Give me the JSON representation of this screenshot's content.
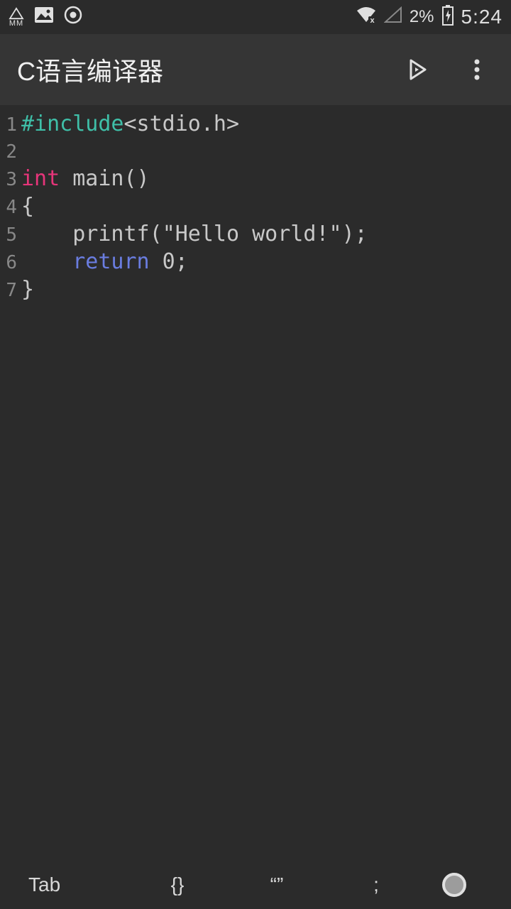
{
  "status": {
    "battery_pct": "2%",
    "time": "5:24",
    "mm_label": "MM"
  },
  "header": {
    "title": "C语言编译器"
  },
  "code": {
    "lines": [
      {
        "n": "1",
        "segments": [
          {
            "t": "#include",
            "c": "k-pre"
          },
          {
            "t": "<stdio.h>",
            "c": ""
          }
        ]
      },
      {
        "n": "2",
        "segments": []
      },
      {
        "n": "3",
        "segments": [
          {
            "t": "int",
            "c": "k-type"
          },
          {
            "t": " main()",
            "c": ""
          }
        ]
      },
      {
        "n": "4",
        "segments": [
          {
            "t": "{",
            "c": ""
          }
        ]
      },
      {
        "n": "5",
        "segments": [
          {
            "t": "    printf(",
            "c": ""
          },
          {
            "t": "\"Hello world!\"",
            "c": "k-str"
          },
          {
            "t": ");",
            "c": ""
          }
        ]
      },
      {
        "n": "6",
        "segments": [
          {
            "t": "    ",
            "c": ""
          },
          {
            "t": "return",
            "c": "k-ret"
          },
          {
            "t": " 0;",
            "c": ""
          }
        ]
      },
      {
        "n": "7",
        "segments": [
          {
            "t": "}",
            "c": ""
          }
        ]
      }
    ]
  },
  "keys": {
    "tab": "Tab",
    "braces": "{}",
    "quotes": "“”",
    "semicolon": ";"
  }
}
